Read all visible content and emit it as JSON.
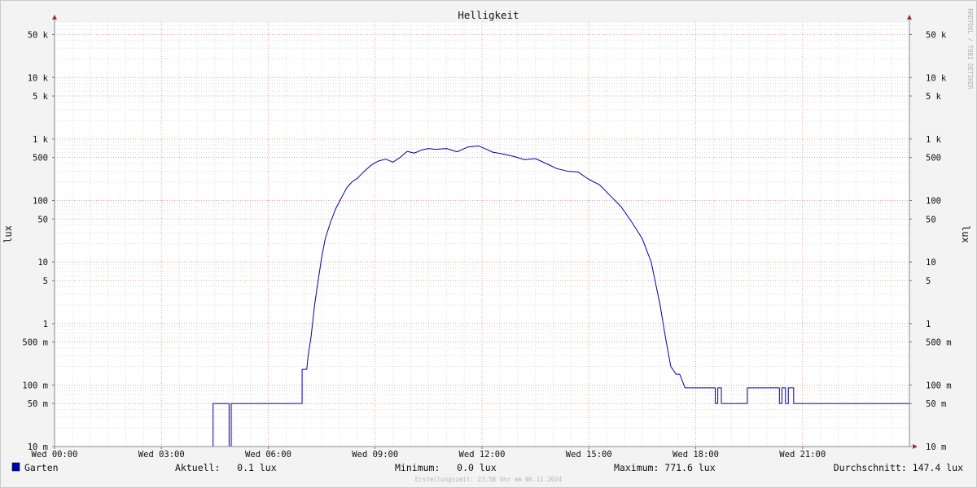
{
  "chart_data": {
    "type": "line",
    "title": "Helligkeit",
    "ylabel": "lux",
    "yscale": "log",
    "ylim": [
      0.01,
      80000
    ],
    "xlim": [
      0,
      24
    ],
    "x_ticks": [
      {
        "v": 0,
        "label": "Wed 00:00"
      },
      {
        "v": 3,
        "label": "Wed 03:00"
      },
      {
        "v": 6,
        "label": "Wed 06:00"
      },
      {
        "v": 9,
        "label": "Wed 09:00"
      },
      {
        "v": 12,
        "label": "Wed 12:00"
      },
      {
        "v": 15,
        "label": "Wed 15:00"
      },
      {
        "v": 18,
        "label": "Wed 18:00"
      },
      {
        "v": 21,
        "label": "Wed 21:00"
      }
    ],
    "y_ticks": [
      {
        "v": 50000,
        "label": "50 k"
      },
      {
        "v": 10000,
        "label": "10 k"
      },
      {
        "v": 5000,
        "label": "5 k"
      },
      {
        "v": 1000,
        "label": "1 k"
      },
      {
        "v": 500,
        "label": "500"
      },
      {
        "v": 100,
        "label": "100"
      },
      {
        "v": 50,
        "label": "50"
      },
      {
        "v": 10,
        "label": "10"
      },
      {
        "v": 5,
        "label": "5"
      },
      {
        "v": 1,
        "label": "1"
      },
      {
        "v": 0.5,
        "label": "500 m"
      },
      {
        "v": 0.1,
        "label": "100 m"
      },
      {
        "v": 0.05,
        "label": "50 m"
      },
      {
        "v": 0.01,
        "label": "10 m"
      }
    ],
    "grid": true,
    "series": [
      {
        "name": "Garten",
        "color": "#0000aa",
        "x": [
          0,
          4.45,
          4.45,
          4.9,
          4.9,
          4.96,
          4.96,
          6.95,
          6.95,
          7.08,
          7.12,
          7.2,
          7.3,
          7.4,
          7.5,
          7.6,
          7.75,
          7.9,
          8.05,
          8.2,
          8.35,
          8.5,
          8.7,
          8.9,
          9.1,
          9.3,
          9.5,
          9.6,
          9.7,
          9.9,
          10.1,
          10.3,
          10.5,
          10.7,
          11.0,
          11.3,
          11.6,
          11.9,
          12.1,
          12.3,
          12.6,
          12.9,
          13.2,
          13.5,
          13.8,
          14.1,
          14.4,
          14.7,
          15.0,
          15.3,
          15.6,
          15.9,
          16.2,
          16.5,
          16.75,
          17.0,
          17.15,
          17.3,
          17.45,
          17.55,
          17.7,
          17.78,
          17.78,
          18.55,
          18.55,
          18.62,
          18.62,
          18.72,
          18.72,
          18.78,
          18.78,
          19.45,
          19.45,
          20.35,
          20.35,
          20.42,
          20.42,
          20.52,
          20.52,
          20.6,
          20.6,
          20.75,
          20.75,
          24
        ],
        "y": [
          0.01,
          0.01,
          0.05,
          0.05,
          0.01,
          0.01,
          0.05,
          0.05,
          0.18,
          0.18,
          0.3,
          0.6,
          2,
          5,
          12,
          24,
          45,
          75,
          110,
          160,
          200,
          230,
          300,
          380,
          440,
          470,
          420,
          460,
          500,
          630,
          590,
          660,
          700,
          680,
          700,
          620,
          740,
          771.6,
          690,
          610,
          570,
          520,
          460,
          480,
          400,
          330,
          300,
          290,
          220,
          180,
          120,
          80,
          45,
          24,
          10,
          2,
          0.6,
          0.2,
          0.15,
          0.15,
          0.09,
          0.09,
          0.09,
          0.09,
          0.05,
          0.05,
          0.09,
          0.09,
          0.05,
          0.05,
          0.05,
          0.05,
          0.09,
          0.09,
          0.05,
          0.05,
          0.09,
          0.09,
          0.05,
          0.05,
          0.09,
          0.09,
          0.05,
          0.05
        ]
      }
    ]
  },
  "watermark": "RRDTOOL / TOBI OETIKER",
  "legend": {
    "series_name": "Garten",
    "color": "#0000aa",
    "current": "Aktuell:   0.1 lux",
    "minimum": "Minimum:   0.0 lux",
    "maximum": "Maximum: 771.6 lux",
    "average": "Durchschnitt: 147.4 lux"
  },
  "footer": "Erstellungszeit: 23:58 Uhr am 06.11.2024"
}
